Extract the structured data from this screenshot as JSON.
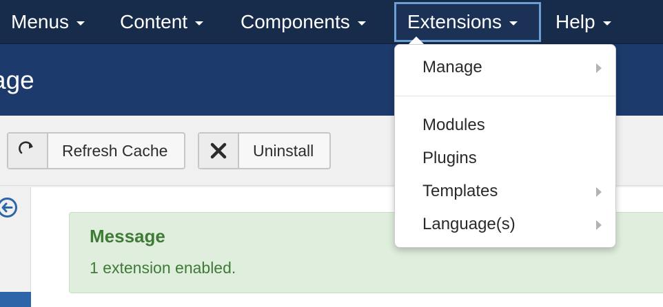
{
  "navbar": {
    "items": [
      {
        "label": "Menus"
      },
      {
        "label": "Content"
      },
      {
        "label": "Components"
      },
      {
        "label": "Extensions"
      },
      {
        "label": "Help"
      }
    ]
  },
  "header": {
    "title": "age"
  },
  "toolbar": {
    "refresh_label": "Refresh Cache",
    "uninstall_label": "Uninstall"
  },
  "alert": {
    "heading": "Message",
    "text": "1 extension enabled."
  },
  "dropdown": {
    "items": [
      {
        "label": "Manage"
      },
      {
        "label": "Modules"
      },
      {
        "label": "Plugins"
      },
      {
        "label": "Templates"
      },
      {
        "label": "Language(s)"
      }
    ]
  },
  "colors": {
    "navbar": "#172b4a",
    "titlebar": "#1c3a6b",
    "active_border": "#6b9fd6",
    "alert_bg": "#dfeedd",
    "alert_text": "#3f7a37"
  },
  "icons": {
    "refresh": "refresh-icon",
    "uninstall": "close-icon",
    "back": "arrow-circle-left-icon"
  }
}
